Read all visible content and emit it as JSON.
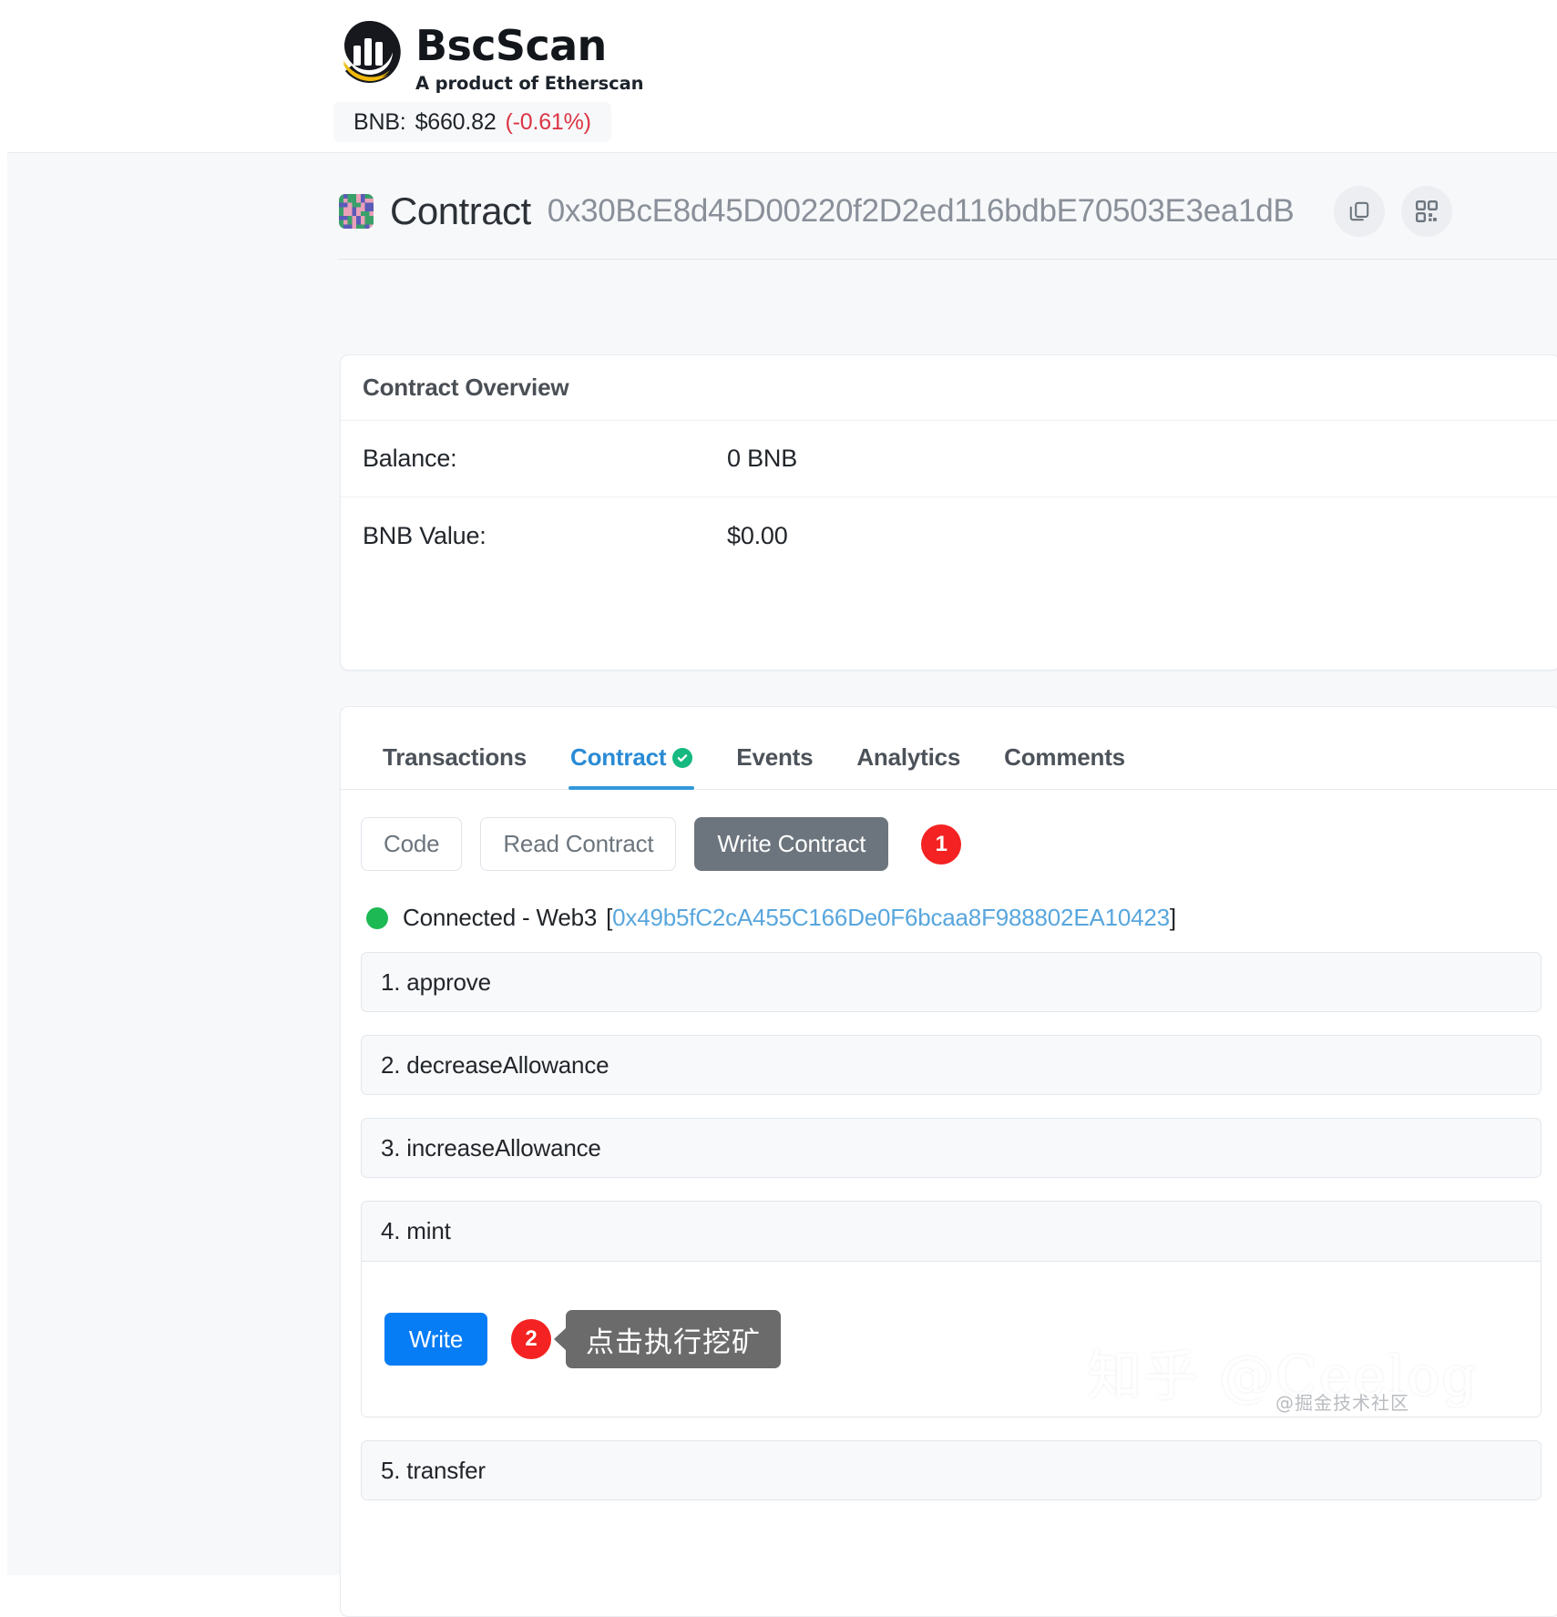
{
  "header": {
    "brand_name": "BscScan",
    "brand_tagline": "A product of Etherscan",
    "price_label": "BNB:",
    "price_value": "$660.82",
    "price_change": "(-0.61%)",
    "price_change_color": "#dc3545"
  },
  "contract": {
    "title": "Contract",
    "address": "0x30BcE8d45D00220f2D2ed116bdbE70503E3ea1dB",
    "copy_icon": "copy-icon",
    "qr_icon": "qr-code-icon"
  },
  "overview": {
    "title": "Contract Overview",
    "rows": [
      {
        "label": "Balance:",
        "value": "0 BNB"
      },
      {
        "label": "BNB Value:",
        "value": "$0.00"
      }
    ]
  },
  "tabs": {
    "items": [
      {
        "label": "Transactions",
        "active": false,
        "verified": false
      },
      {
        "label": "Contract",
        "active": true,
        "verified": true
      },
      {
        "label": "Events",
        "active": false,
        "verified": false
      },
      {
        "label": "Analytics",
        "active": false,
        "verified": false
      },
      {
        "label": "Comments",
        "active": false,
        "verified": false
      }
    ],
    "active_color": "#3498db",
    "verified_color": "#16b97f"
  },
  "subtabs": {
    "items": [
      {
        "label": "Code",
        "active": false
      },
      {
        "label": "Read Contract",
        "active": false
      },
      {
        "label": "Write Contract",
        "active": true
      }
    ],
    "badge": "1",
    "badge_color": "#f42222",
    "active_bg": "#6c757d"
  },
  "connection": {
    "status_text": "Connected - Web3",
    "bracket_open": "[",
    "address": "0x49b5fC2cA455C166De0F6bcaa8F988802EA10423",
    "bracket_close": "]",
    "dot_color": "#1db954",
    "address_color": "#58a6dd"
  },
  "functions": {
    "items": [
      {
        "label": "1. approve",
        "expanded": false
      },
      {
        "label": "2. decreaseAllowance",
        "expanded": false
      },
      {
        "label": "3. increaseAllowance",
        "expanded": false
      },
      {
        "label": "4. mint",
        "expanded": true
      },
      {
        "label": "5. transfer",
        "expanded": false
      }
    ]
  },
  "mint_panel": {
    "write_label": "Write",
    "write_color": "#067cf5",
    "badge": "2",
    "badge_color": "#f42222",
    "tooltip_text": "点击执行挖矿",
    "tooltip_bg": "#6b6b6b"
  },
  "watermarks": {
    "zhihu": "知乎 @Ceelog",
    "juejin": "@掘金技术社区"
  }
}
